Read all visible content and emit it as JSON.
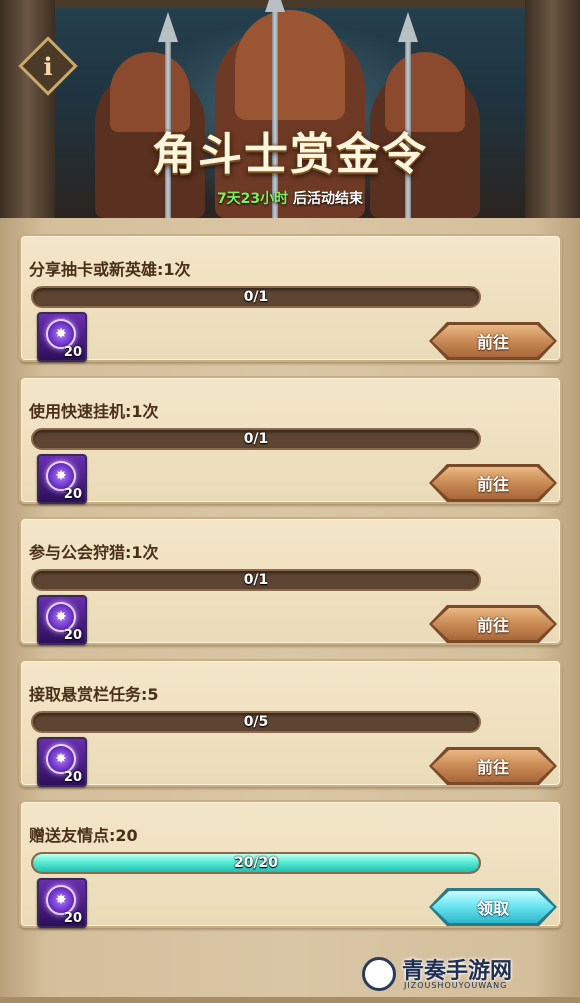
{
  "header": {
    "title": "角斗士赏金令",
    "countdown": "7天23小时",
    "countdown_suffix": " 后活动结束",
    "info_label": "i"
  },
  "colors": {
    "progress_fill": "#5ef0d8",
    "countdown_green": "#7cf05c",
    "reward_purple": "#6a2fb0"
  },
  "quests": [
    {
      "title": "分享抽卡或新英雄:1次",
      "progress": "0/1",
      "ratio": 0,
      "reward_qty": "20",
      "reward_icon": "purple-orb-icon",
      "button": "前往"
    },
    {
      "title": "使用快速挂机:1次",
      "progress": "0/1",
      "ratio": 0,
      "reward_qty": "20",
      "reward_icon": "purple-orb-icon",
      "button": "前往"
    },
    {
      "title": "参与公会狩猎:1次",
      "progress": "0/1",
      "ratio": 0,
      "reward_qty": "20",
      "reward_icon": "purple-orb-icon",
      "button": "前往"
    },
    {
      "title": "接取悬赏栏任务:5",
      "progress": "0/5",
      "ratio": 0,
      "reward_qty": "20",
      "reward_icon": "purple-orb-icon",
      "button": "前往"
    },
    {
      "title": "赠送友情点:20",
      "progress": "20/20",
      "ratio": 1,
      "reward_qty": "20",
      "reward_icon": "purple-orb-icon",
      "button": "领取"
    }
  ],
  "watermark": {
    "text": "青奏手游网",
    "sub": "JIZOUSHOUYOUWANG"
  }
}
